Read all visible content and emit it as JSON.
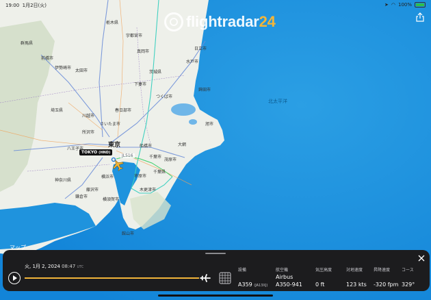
{
  "status": {
    "time": "19:00",
    "date": "1月2日(火)",
    "battery": "100%"
  },
  "logo": {
    "word": "flightradar",
    "num": "24"
  },
  "map": {
    "sea_label": "北太平洋",
    "labels": [
      "栃木県",
      "宇都宮市",
      "群馬県",
      "前橋市",
      "伊勢崎市",
      "太田市",
      "真岡市",
      "茨城県",
      "水戸市",
      "下妻市",
      "つくば市",
      "埼玉県",
      "春日部市",
      "川越市",
      "さいたま市",
      "所沢市",
      "八王子市",
      "東京",
      "船橋市",
      "千葉市",
      "千葉県",
      "市原市",
      "神奈川県",
      "藤沢市",
      "横浜市",
      "鎌倉市",
      "横須賀市",
      "木更津市",
      "館山市",
      "鉾田市",
      "日立市",
      "旭市",
      "大網",
      "茂原市"
    ],
    "major_label": "東京",
    "airport_label": "TOKYO",
    "airport_code": "(HND)",
    "flight_label": "JL516",
    "attribution": "マップ"
  },
  "playback": {
    "date": "火, 1月 2, 2024",
    "time": "08:47",
    "tz": "UTC",
    "progress": 0.98
  },
  "columns": [
    {
      "label": "設備",
      "value": "A359",
      "reg": "(JA13XJ)"
    },
    {
      "label": "航空機",
      "value_line1": "Airbus",
      "value_line2": "A350-941"
    },
    {
      "label": "気圧高度",
      "value": "0 ft"
    },
    {
      "label": "対地速度",
      "value": "123 kts"
    },
    {
      "label": "昇降速度",
      "value": "-320 fpm"
    },
    {
      "label": "コース",
      "value": "329°"
    }
  ],
  "colors": {
    "sea": "#1aa0e6",
    "land": "#eef0ea",
    "track": "#f2b53a",
    "route_green": "#3ecf6a",
    "panel": "#1c1c1e"
  }
}
